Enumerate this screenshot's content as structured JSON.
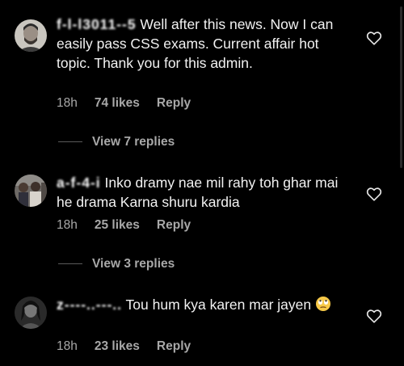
{
  "comments": [
    {
      "username": "f-l-l3011--5",
      "text": " Well after this news. Now I can easily pass CSS exams. Current affair hot topic.  Thank you for this admin.",
      "time": "18h",
      "likes": "74 likes",
      "reply": "Reply",
      "view_replies": "View 7 replies",
      "avatar_icon": "man-portrait-avatar"
    },
    {
      "username": "a-f-4-i",
      "text": " Inko dramy nae mil rahy toh ghar mai he drama Karna shuru kardia",
      "time": "18h",
      "likes": "25 likes",
      "reply": "Reply",
      "view_replies": "View 3 replies",
      "avatar_icon": "group-photo-avatar"
    },
    {
      "username": "z----..---..",
      "text": " Tou hum kya karen mar jayen ",
      "time": "18h",
      "likes": "23 likes",
      "reply": "Reply",
      "emoji": "face-with-rolling-eyes-emoji",
      "avatar_icon": "dark-portrait-avatar"
    }
  ],
  "colors": {
    "background": "#000000",
    "text": "#f2f2f2",
    "secondary": "#a8a8a8"
  },
  "icons": {
    "heart": "heart-outline-icon"
  }
}
